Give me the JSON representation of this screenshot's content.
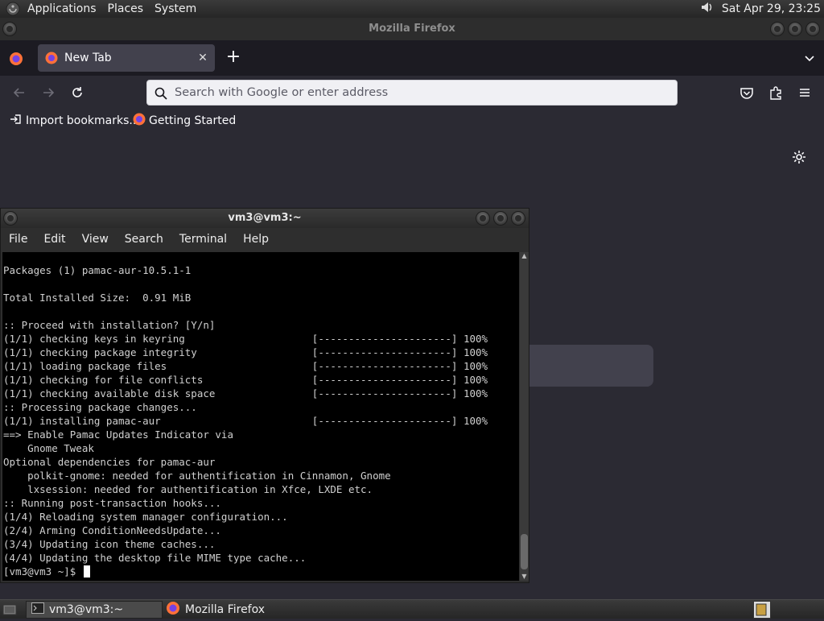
{
  "top_panel": {
    "menus": [
      "Applications",
      "Places",
      "System"
    ],
    "clock": "Sat Apr 29, 23:25"
  },
  "firefox": {
    "window_title": "Mozilla Firefox",
    "tab_title": "New Tab",
    "url_placeholder": "Search with Google or enter address",
    "bookmarks": [
      "Import bookmarks...",
      "Getting Started"
    ]
  },
  "terminal": {
    "window_title": "vm3@vm3:~",
    "menus": [
      "File",
      "Edit",
      "View",
      "Search",
      "Terminal",
      "Help"
    ],
    "lines": [
      "Packages (1) pamac-aur-10.5.1-1",
      "",
      "Total Installed Size:  0.91 MiB",
      "",
      ":: Proceed with installation? [Y/n]",
      "(1/1) checking keys in keyring                     [----------------------] 100%",
      "(1/1) checking package integrity                   [----------------------] 100%",
      "(1/1) loading package files                        [----------------------] 100%",
      "(1/1) checking for file conflicts                  [----------------------] 100%",
      "(1/1) checking available disk space                [----------------------] 100%",
      ":: Processing package changes...",
      "(1/1) installing pamac-aur                         [----------------------] 100%",
      "==> Enable Pamac Updates Indicator via",
      "    Gnome Tweak",
      "Optional dependencies for pamac-aur",
      "    polkit-gnome: needed for authentification in Cinnamon, Gnome",
      "    lxsession: needed for authentification in Xfce, LXDE etc.",
      ":: Running post-transaction hooks...",
      "(1/4) Reloading system manager configuration...",
      "(2/4) Arming ConditionNeedsUpdate...",
      "(3/4) Updating icon theme caches...",
      "(4/4) Updating the desktop file MIME type cache..."
    ],
    "prompt": "[vm3@vm3 ~]$ "
  },
  "taskbar": {
    "items": [
      "vm3@vm3:~",
      "Mozilla Firefox"
    ]
  },
  "colors": {
    "firefox_bg": "#2b2a33",
    "tab_active": "#42414d",
    "terminal_bg": "#000000",
    "terminal_fg": "#d0d0d0"
  }
}
